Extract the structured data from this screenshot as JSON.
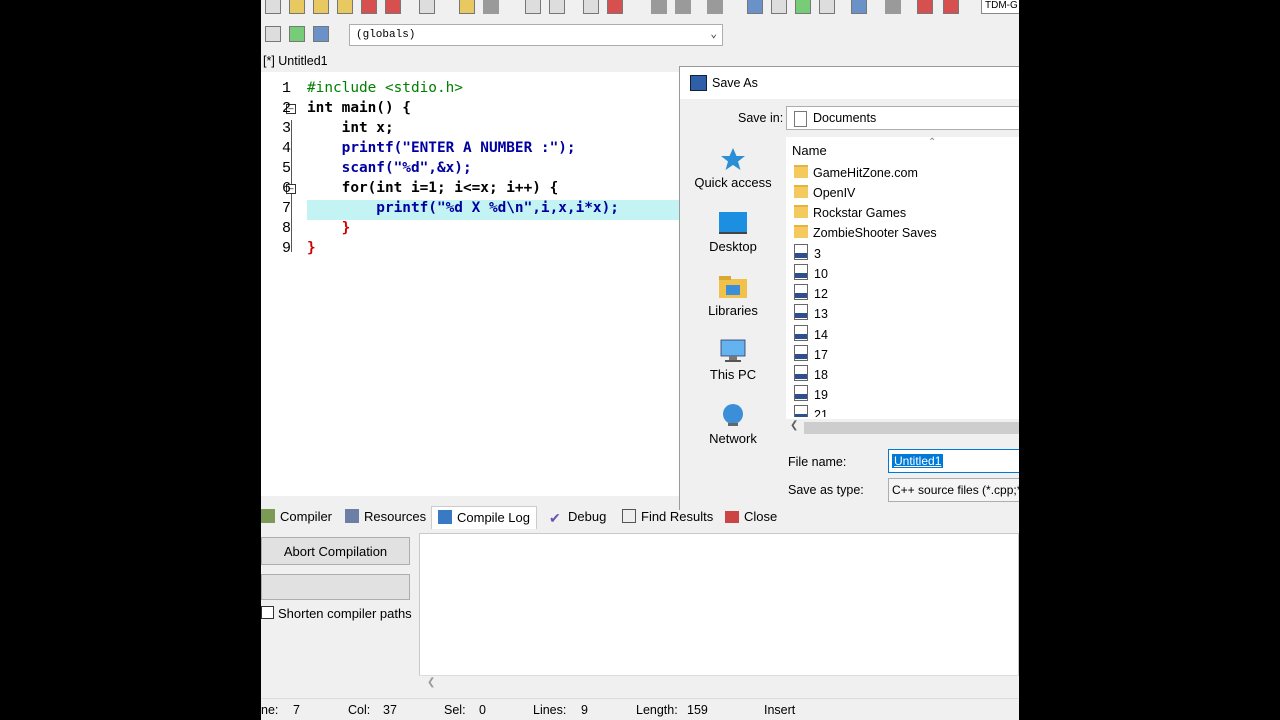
{
  "toolbar": {
    "compiler_label": "TDM-G"
  },
  "scope_dropdown": {
    "value": "(globals)"
  },
  "editor_tab": {
    "label": "[*] Untitled1"
  },
  "editor": {
    "line_numbers": [
      "1",
      "2",
      "3",
      "4",
      "5",
      "6",
      "7",
      "8",
      "9"
    ],
    "lines": [
      "#include <stdio.h>",
      "int main() {",
      "    int x;",
      "    printf(\"ENTER A NUMBER :\");",
      "    scanf(\"%d\",&x);",
      "    for(int i=1; i<=x; i++) {",
      "        printf(\"%d X %d\\n\",i,x,i*x);",
      "    }",
      "}"
    ]
  },
  "bottom_tabs": [
    "Compiler",
    "Resources",
    "Compile Log",
    "Debug",
    "Find Results",
    "Close"
  ],
  "compile_panel": {
    "abort_label": "Abort Compilation",
    "shorten_label": "Shorten compiler paths"
  },
  "statusbar": {
    "line_label": "ne:",
    "line": "7",
    "col_label": "Col:",
    "col": "37",
    "sel_label": "Sel:",
    "sel": "0",
    "lines_label": "Lines:",
    "lines": "9",
    "length_label": "Length:",
    "length": "159",
    "mode": "Insert"
  },
  "save_dialog": {
    "title": "Save As",
    "save_in_label": "Save in:",
    "save_in_value": "Documents",
    "places": [
      "Quick access",
      "Desktop",
      "Libraries",
      "This PC",
      "Network"
    ],
    "column_header": "Name",
    "items": [
      {
        "name": "GameHitZone.com",
        "type": "folder"
      },
      {
        "name": "OpenIV",
        "type": "folder"
      },
      {
        "name": "Rockstar Games",
        "type": "folder"
      },
      {
        "name": "ZombieShooter Saves",
        "type": "folder"
      },
      {
        "name": "3",
        "type": "cpp"
      },
      {
        "name": "10",
        "type": "cpp"
      },
      {
        "name": "12",
        "type": "cpp"
      },
      {
        "name": "13",
        "type": "cpp"
      },
      {
        "name": "14",
        "type": "cpp"
      },
      {
        "name": "17",
        "type": "cpp"
      },
      {
        "name": "18",
        "type": "cpp"
      },
      {
        "name": "19",
        "type": "cpp"
      },
      {
        "name": "21",
        "type": "cpp"
      }
    ],
    "file_name_label": "File name:",
    "file_name_value": "Untitled1",
    "save_type_label": "Save as type:",
    "save_type_value": "C++ source files (*.cpp;*.c"
  },
  "colors": {
    "highlight_line": "#c4f3f3",
    "keyword": "#000000",
    "string": "#0000a0",
    "paren": "#cc0000",
    "preprocessor": "#008000",
    "accent": "#0078d7"
  }
}
